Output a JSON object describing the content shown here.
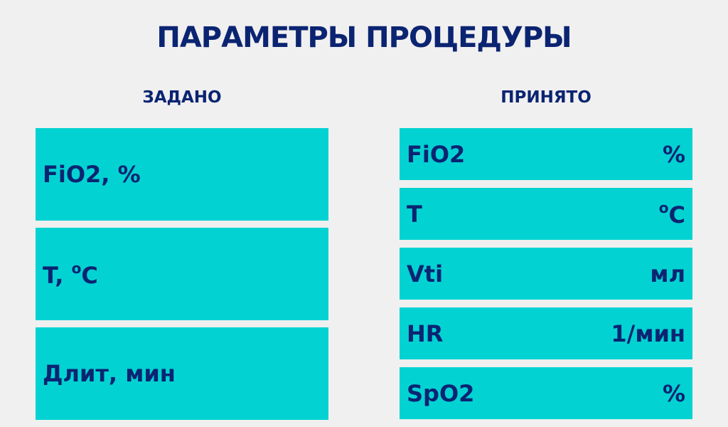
{
  "title": "ПАРАМЕТРЫ ПРОЦЕДУРЫ",
  "colors": {
    "box": "#03d2d2",
    "text": "#0b2472",
    "background": "#f0f0f0"
  },
  "set": {
    "header": "ЗАДАНО",
    "items": [
      {
        "label": "FiO2, %"
      },
      {
        "label": "T, ",
        "sup": "o",
        "unit": "C"
      },
      {
        "label": "Длит, мин"
      }
    ]
  },
  "received": {
    "header": "ПРИНЯТО",
    "items": [
      {
        "label": "FiO2",
        "unit": "%"
      },
      {
        "label": "T",
        "sup": "o",
        "unit": "C"
      },
      {
        "label": "Vti",
        "unit": "мл"
      },
      {
        "label": "HR",
        "unit": "1/мин"
      },
      {
        "label": "SpO2",
        "unit": "%"
      }
    ]
  }
}
